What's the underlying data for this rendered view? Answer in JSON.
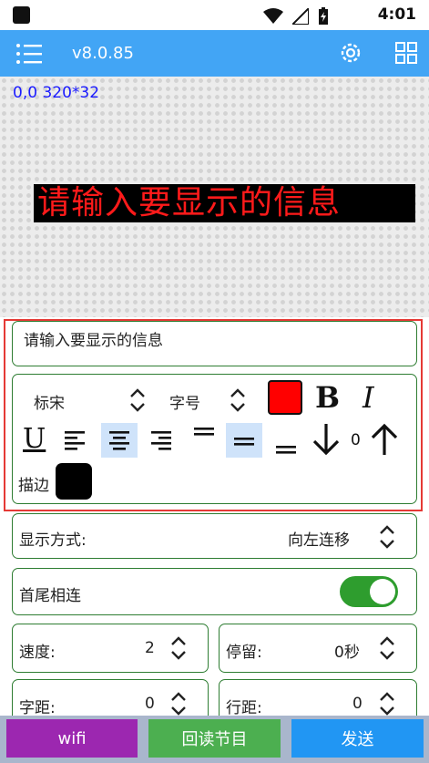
{
  "status_bar": {
    "time": "4:01"
  },
  "app_bar": {
    "version": "v8.0.85",
    "icons": [
      "menu-icon",
      "gear-icon",
      "grid-icon"
    ]
  },
  "preview": {
    "coords": "0,0 320*32",
    "led_text": "请输入要显示的信息",
    "led_color": "#ff1a1a"
  },
  "editor": {
    "message": "请输入要显示的信息",
    "font": "标宋",
    "font_size_label": "字号",
    "text_color": "#ff0000",
    "bold_label": "B",
    "italic_label": "I",
    "underline_label": "U",
    "line_spacing": "0",
    "border_label": "描边",
    "border_color": "#000000"
  },
  "settings": {
    "display_mode_label": "显示方式:",
    "display_mode_value": "向左连移",
    "loop_label": "首尾相连",
    "loop_on": true,
    "speed_label": "速度:",
    "speed_value": "2",
    "pause_label": "停留:",
    "pause_value": "0秒",
    "char_spacing_label": "字距:",
    "char_spacing_value": "0",
    "line_spacing_label": "行距:",
    "line_spacing_value": "0"
  },
  "bottom_buttons": [
    {
      "label": "wifi",
      "color": "#9c27b0"
    },
    {
      "label": "回读节目",
      "color": "#4caf50"
    },
    {
      "label": "发送",
      "color": "#2196f3"
    }
  ]
}
